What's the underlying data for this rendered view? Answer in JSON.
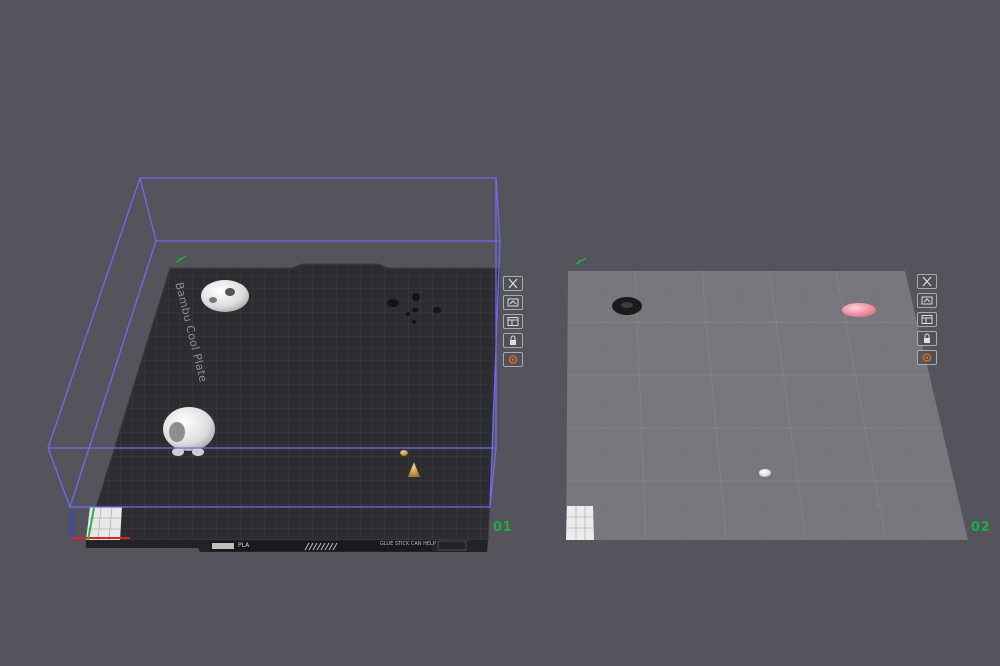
{
  "viewport": {
    "background": "#55545c",
    "selected_plate_outline": "#6f6cf0",
    "plate_number_color": "#1fae3f"
  },
  "plates": [
    {
      "number": "01",
      "label": "Bambu Cool Plate",
      "tag_filament": "PLA",
      "tag_notice_line1": "GLUE STICK CAN HELP",
      "selected": true,
      "objects": 8,
      "tools": [
        "close-icon",
        "auto-orient-icon",
        "arrange-icon",
        "lock-icon",
        "settings-icon"
      ]
    },
    {
      "number": "02",
      "selected": false,
      "objects": 3,
      "tools": [
        "close-icon",
        "auto-orient-icon",
        "arrange-icon",
        "lock-icon",
        "settings-icon"
      ]
    }
  ]
}
